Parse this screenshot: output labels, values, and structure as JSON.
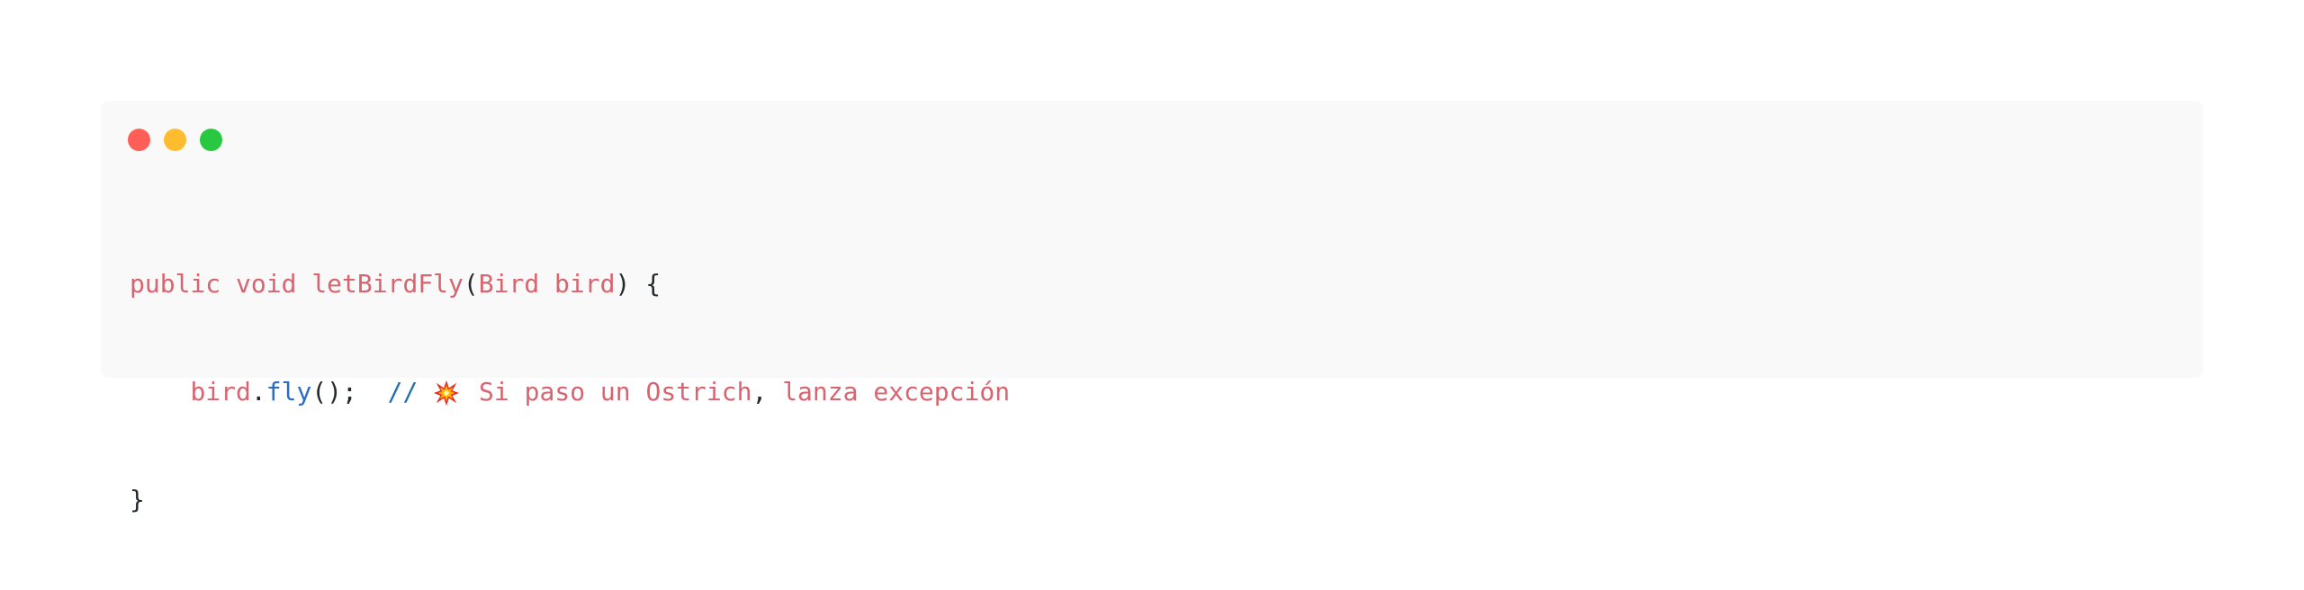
{
  "window": {
    "controls": [
      "close",
      "minimize",
      "maximize"
    ]
  },
  "code": {
    "line1": {
      "public": "public",
      "void": "void",
      "name": "letBirdFly",
      "lparen": "(",
      "type": "Bird",
      "param": "bird",
      "rparen": ")",
      "brace": "{"
    },
    "line2": {
      "indent": "    ",
      "obj": "bird",
      "dot": ".",
      "method": "fly",
      "call": "();",
      "comment_slash": "//",
      "emoji": "collision-icon",
      "comment_text_a": "Si paso un Ostrich",
      "comma": ",",
      "comment_text_b": "lanza excepción"
    },
    "line3": {
      "brace": "}"
    }
  },
  "colors": {
    "background": "#f9f9f9",
    "keyword": "#d7646f",
    "method": "#2d6cc6",
    "comment_slash": "#1f6fb5",
    "text": "#24292e"
  }
}
